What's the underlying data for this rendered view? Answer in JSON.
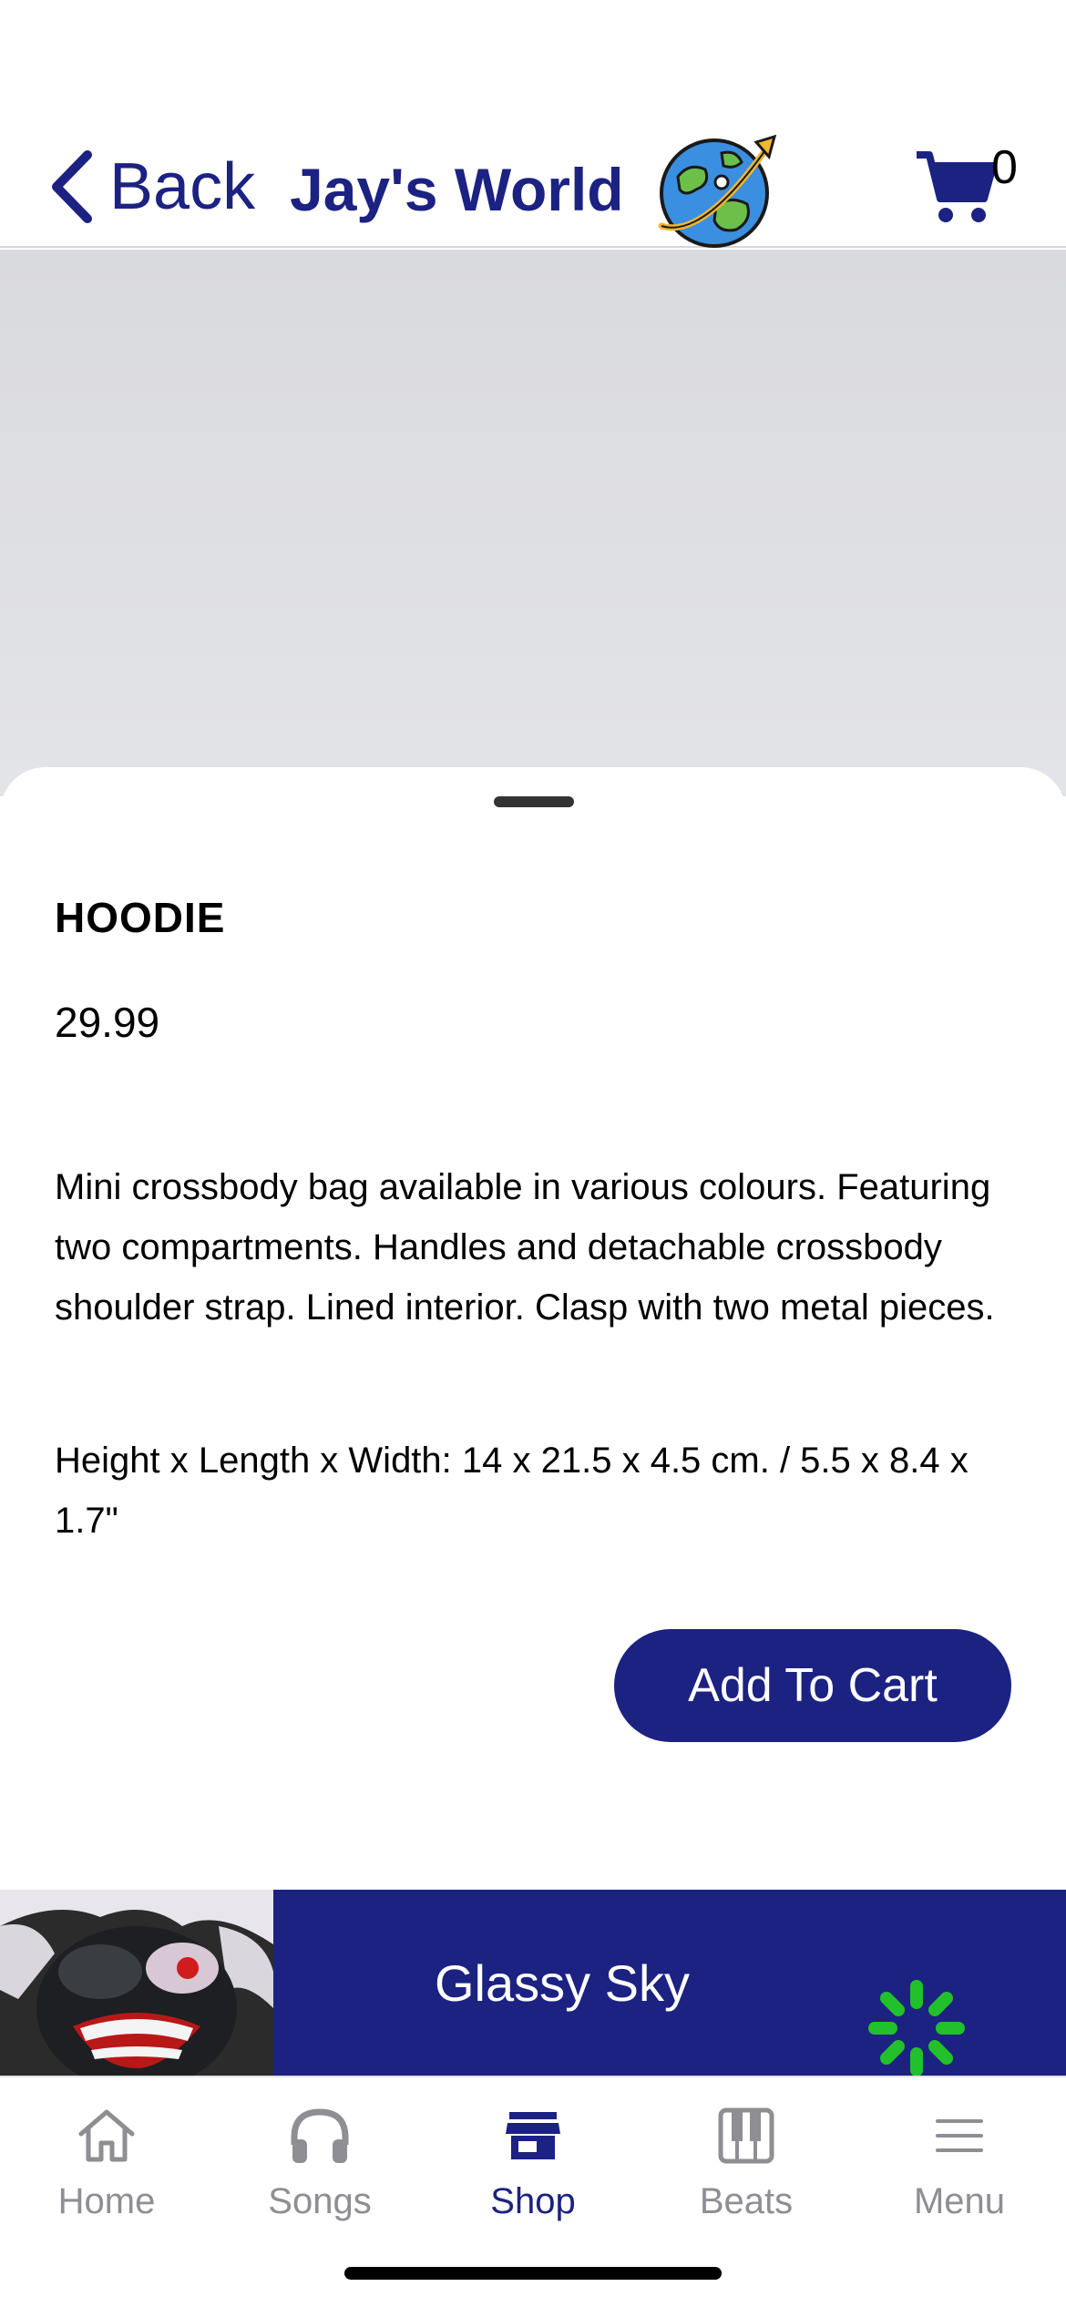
{
  "header": {
    "back_label": "Back",
    "title": "Jay's World",
    "cart_count": "0",
    "accent_color": "#1c2282"
  },
  "product": {
    "name": "HOODIE",
    "price": "29.99",
    "description": "Mini crossbody bag available in various colours. Featuring two compartments. Handles and detachable crossbody shoulder strap. Lined interior. Clasp with two metal pieces.",
    "dimensions": "Height x Length x Width: 14 x 21.5 x 4.5 cm. / 5.5 x 8.4 x 1.7\"",
    "add_to_cart_label": "Add To Cart"
  },
  "player": {
    "track_title": "Glassy Sky",
    "loading_indicator_color": "#22c02a"
  },
  "tabs": [
    {
      "label": "Home",
      "icon": "house-icon",
      "active": false
    },
    {
      "label": "Songs",
      "icon": "headphones-icon",
      "active": false
    },
    {
      "label": "Shop",
      "icon": "storefront-icon",
      "active": true
    },
    {
      "label": "Beats",
      "icon": "piano-icon",
      "active": false
    },
    {
      "label": "Menu",
      "icon": "hamburger-icon",
      "active": false
    }
  ]
}
